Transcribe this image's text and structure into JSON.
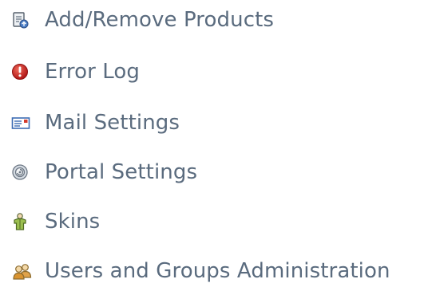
{
  "menu": {
    "items": [
      {
        "label": "Add/Remove Products",
        "icon": "add-remove-products-icon"
      },
      {
        "label": "Error Log",
        "icon": "error-icon"
      },
      {
        "label": "Mail Settings",
        "icon": "mail-icon"
      },
      {
        "label": "Portal Settings",
        "icon": "portal-settings-icon"
      },
      {
        "label": "Skins",
        "icon": "skins-icon"
      },
      {
        "label": "Users and Groups Administration",
        "icon": "users-groups-icon"
      }
    ]
  },
  "colors": {
    "link_text": "#5a6b7e",
    "error_red": "#c81d1d",
    "background": "#ffffff"
  }
}
